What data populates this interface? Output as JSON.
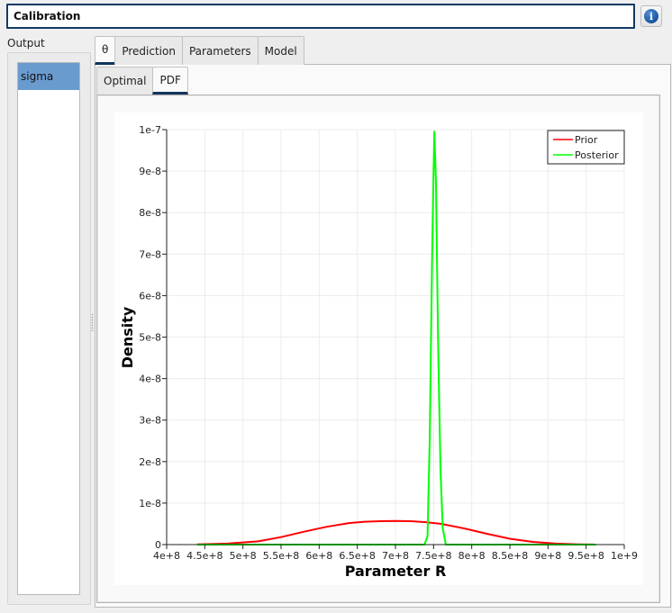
{
  "header": {
    "title": "Calibration",
    "info_icon": "info-icon"
  },
  "sidebar": {
    "label": "Output",
    "items": [
      {
        "label": "sigma",
        "selected": true
      }
    ]
  },
  "tabs": {
    "outer": [
      {
        "label": "θ",
        "active": true
      },
      {
        "label": "Prediction",
        "active": false
      },
      {
        "label": "Parameters",
        "active": false
      },
      {
        "label": "Model",
        "active": false
      }
    ],
    "inner": [
      {
        "label": "Optimal",
        "active": false
      },
      {
        "label": "PDF",
        "active": true
      }
    ]
  },
  "colors": {
    "accent": "#12345c",
    "selection": "#6a9bcf",
    "prior": "#ff0000",
    "posterior": "#00ff00"
  },
  "chart_data": {
    "type": "line",
    "title": "",
    "xlabel": "Parameter R",
    "ylabel": "Density",
    "xlim": [
      400000000,
      1000000000
    ],
    "ylim": [
      0,
      1e-07
    ],
    "grid": true,
    "legend_position": "top-right",
    "x_ticks": [
      {
        "value": 400000000,
        "label": "4e+8"
      },
      {
        "value": 450000000,
        "label": "4.5e+8"
      },
      {
        "value": 500000000,
        "label": "5e+8"
      },
      {
        "value": 550000000,
        "label": "5.5e+8"
      },
      {
        "value": 600000000,
        "label": "6e+8"
      },
      {
        "value": 650000000,
        "label": "6.5e+8"
      },
      {
        "value": 700000000,
        "label": "7e+8"
      },
      {
        "value": 750000000,
        "label": "7.5e+8"
      },
      {
        "value": 800000000,
        "label": "8e+8"
      },
      {
        "value": 850000000,
        "label": "8.5e+8"
      },
      {
        "value": 900000000,
        "label": "9e+8"
      },
      {
        "value": 950000000,
        "label": "9.5e+8"
      },
      {
        "value": 1000000000,
        "label": "1e+9"
      }
    ],
    "y_ticks": [
      {
        "value": 0,
        "label": "0"
      },
      {
        "value": 1e-08,
        "label": "1e-8"
      },
      {
        "value": 2e-08,
        "label": "2e-8"
      },
      {
        "value": 3e-08,
        "label": "3e-8"
      },
      {
        "value": 4e-08,
        "label": "4e-8"
      },
      {
        "value": 5e-08,
        "label": "5e-8"
      },
      {
        "value": 6e-08,
        "label": "6e-8"
      },
      {
        "value": 7e-08,
        "label": "7e-8"
      },
      {
        "value": 8e-08,
        "label": "8e-8"
      },
      {
        "value": 9e-08,
        "label": "9e-8"
      },
      {
        "value": 1e-07,
        "label": "1e-7"
      }
    ],
    "series": [
      {
        "name": "Prior",
        "color": "#ff0000",
        "x": [
          440000000,
          480000000,
          520000000,
          550000000,
          580000000,
          610000000,
          640000000,
          660000000,
          680000000,
          700000000,
          720000000,
          740000000,
          760000000,
          790000000,
          820000000,
          850000000,
          880000000,
          910000000,
          940000000,
          960000000
        ],
        "y": [
          5.4e-11,
          2.3e-10,
          7.9e-10,
          1.8e-09,
          3.1e-09,
          4.3e-09,
          5.2e-09,
          5.5e-09,
          5.65e-09,
          5.7e-09,
          5.65e-09,
          5.4e-09,
          5e-09,
          3.9e-09,
          2.6e-09,
          1.4e-09,
          6.4e-10,
          2.3e-10,
          6.7e-11,
          2.7e-11
        ]
      },
      {
        "name": "Posterior",
        "color": "#00ff00",
        "x": [
          440000000,
          700000000,
          738000000,
          742000000,
          745000000,
          748000000,
          750000000,
          751000000,
          752000000,
          753000000,
          754000000,
          756000000,
          759000000,
          762000000,
          766000000,
          800000000,
          963000000
        ],
        "y": [
          0,
          0,
          0,
          2e-09,
          2.6e-08,
          6.8e-08,
          9e-08,
          9.95e-08,
          9.4e-08,
          8.8e-08,
          7.5e-08,
          4.8e-08,
          1.8e-08,
          4e-09,
          0,
          0,
          0
        ]
      }
    ]
  }
}
